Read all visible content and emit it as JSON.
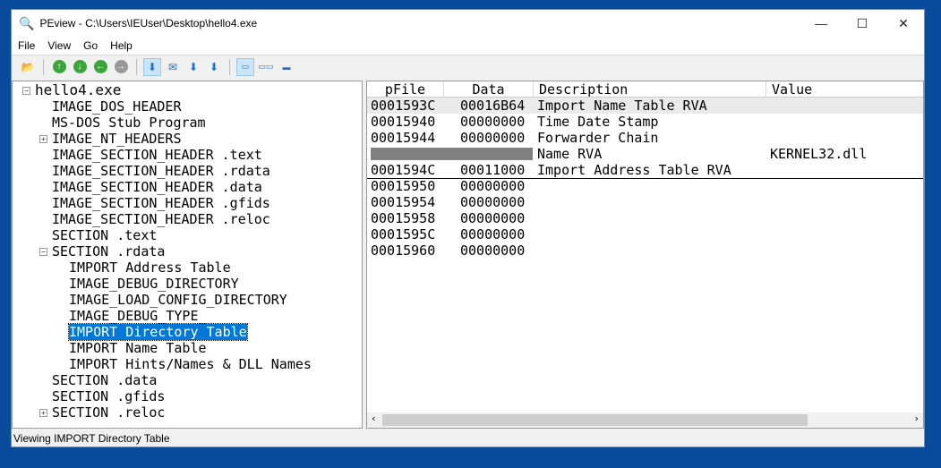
{
  "window": {
    "title": "PEview - C:\\Users\\IEUser\\Desktop\\hello4.exe",
    "minimize": "—",
    "maximize": "☐",
    "close": "✕"
  },
  "menu": [
    "File",
    "View",
    "Go",
    "Help"
  ],
  "tree": [
    {
      "label": "hello4.exe",
      "level": 0,
      "expander": "-"
    },
    {
      "label": "IMAGE_DOS_HEADER",
      "level": 1
    },
    {
      "label": "MS-DOS Stub Program",
      "level": 1
    },
    {
      "label": "IMAGE_NT_HEADERS",
      "level": 1,
      "expander": "+"
    },
    {
      "label": "IMAGE_SECTION_HEADER .text",
      "level": 1
    },
    {
      "label": "IMAGE_SECTION_HEADER .rdata",
      "level": 1
    },
    {
      "label": "IMAGE_SECTION_HEADER .data",
      "level": 1
    },
    {
      "label": "IMAGE_SECTION_HEADER .gfids",
      "level": 1
    },
    {
      "label": "IMAGE_SECTION_HEADER .reloc",
      "level": 1
    },
    {
      "label": "SECTION .text",
      "level": 1
    },
    {
      "label": "SECTION .rdata",
      "level": 1,
      "expander": "-"
    },
    {
      "label": "IMPORT Address Table",
      "level": 2
    },
    {
      "label": "IMAGE_DEBUG_DIRECTORY",
      "level": 2
    },
    {
      "label": "IMAGE_LOAD_CONFIG_DIRECTORY",
      "level": 2
    },
    {
      "label": "IMAGE_DEBUG_TYPE_",
      "level": 2
    },
    {
      "label": "IMPORT Directory Table",
      "level": 2,
      "selected": true
    },
    {
      "label": "IMPORT Name Table",
      "level": 2
    },
    {
      "label": "IMPORT Hints/Names & DLL Names",
      "level": 2
    },
    {
      "label": "SECTION .data",
      "level": 1
    },
    {
      "label": "SECTION .gfids",
      "level": 1
    },
    {
      "label": "SECTION .reloc",
      "level": 1,
      "expander": "+"
    }
  ],
  "table": {
    "columns": [
      "pFile",
      "Data",
      "Description",
      "Value"
    ],
    "rows": [
      {
        "pfile": "0001593C",
        "data": "00016B64",
        "desc": "Import Name Table RVA",
        "value": ""
      },
      {
        "pfile": "00015940",
        "data": "00000000",
        "desc": "Time Date Stamp",
        "value": ""
      },
      {
        "pfile": "00015944",
        "data": "00000000",
        "desc": "Forwarder Chain",
        "value": ""
      },
      {
        "pfile": "",
        "data": "",
        "desc": "Name RVA",
        "value": "KERNEL32.dll",
        "redacted": true
      },
      {
        "pfile": "0001594C",
        "data": "00011000",
        "desc": "Import Address Table RVA",
        "value": ""
      },
      {
        "pfile": "00015950",
        "data": "00000000",
        "desc": "",
        "value": ""
      },
      {
        "pfile": "00015954",
        "data": "00000000",
        "desc": "",
        "value": ""
      },
      {
        "pfile": "00015958",
        "data": "00000000",
        "desc": "",
        "value": ""
      },
      {
        "pfile": "0001595C",
        "data": "00000000",
        "desc": "",
        "value": ""
      },
      {
        "pfile": "00015960",
        "data": "00000000",
        "desc": "",
        "value": ""
      }
    ]
  },
  "status": "Viewing IMPORT Directory Table"
}
